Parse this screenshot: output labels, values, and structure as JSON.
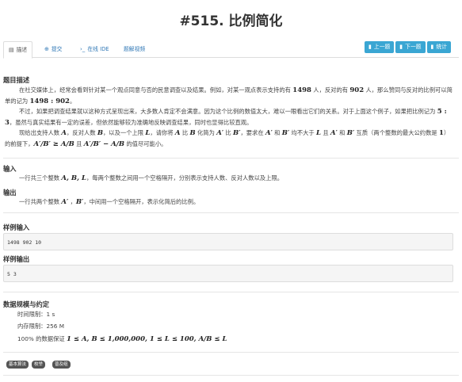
{
  "page_title": "#515. 比例简化",
  "tabs": [
    {
      "icon": "document-icon",
      "label": "描述"
    },
    {
      "icon": "upload-icon",
      "label": "提交"
    },
    {
      "icon": "code-icon",
      "label": "在线 IDE"
    },
    {
      "icon": "",
      "label": "题解视频"
    }
  ],
  "buttons": {
    "prev": "上一题",
    "next": "下一题",
    "stats": "统计"
  },
  "desc": {
    "heading": "题目描述",
    "p1": "在社交媒体上，经常会看到针对某一个观点同意与否的民意调查以及结果。例如，对某一观点表示支持的有",
    "n_support": "1498",
    "p1b": "人，反对的有",
    "n_oppose": "902",
    "p1c": "人，那么赞同与反对的比例可以简单的记为",
    "ratio_full": "1498 : 902",
    "p1d": "。",
    "p2": "不过，如果把调查结果就以这种方式呈现出来，大多数人肯定不会满意。因为这个比例的数值太大，难以一眼看出它们的关系。对于上面这个例子，如果把比例记为",
    "ratio_simple": "5 : 3",
    "p2b": "，虽然与真实结果有一定的误差，但依然能够较为准确地反映调查结果，同时也显得比较直观。",
    "p3": "现给出支持人数",
    "p3b": "，反对人数",
    "p3c": "，以及一个上限",
    "p3d": "，请你将",
    "p3e": "比",
    "p3f": "化简为",
    "p3g": "比",
    "p3h": "，要求在",
    "p3i": "和",
    "p3j": "均不大于",
    "p3k": "且",
    "p3l": "和",
    "p3m": "互质（两个整数的最大公约数是",
    "one": "1",
    "p3n": "）的前提下，",
    "p3o": "且",
    "p3p": "的值尽可能小。"
  },
  "input": {
    "heading": "输入",
    "text": "一行共三个整数",
    "text2": "，每两个整数之间用一个空格隔开，分别表示支持人数、反对人数以及上限。"
  },
  "output": {
    "heading": "输出",
    "text": "一行共两个整数",
    "text2": "，中间用一个空格隔开，表示化简后的比例。"
  },
  "sample_in": {
    "heading": "样例输入",
    "value": "1498 902 10"
  },
  "sample_out": {
    "heading": "样例输出",
    "value": "5 3"
  },
  "limits": {
    "heading": "数据规模与约定",
    "time_label": "时间限制：",
    "time": "1 s",
    "mem_label": "内存限制：",
    "mem": "256 M",
    "cond_label": "100% 的数据保证",
    "cond": "1 ≤ A, B ≤ 1,000,000,  1 ≤ L ≤ 100,  A/B ≤ L"
  },
  "tags": [
    "基本算法",
    "枚举",
    "普及组"
  ]
}
